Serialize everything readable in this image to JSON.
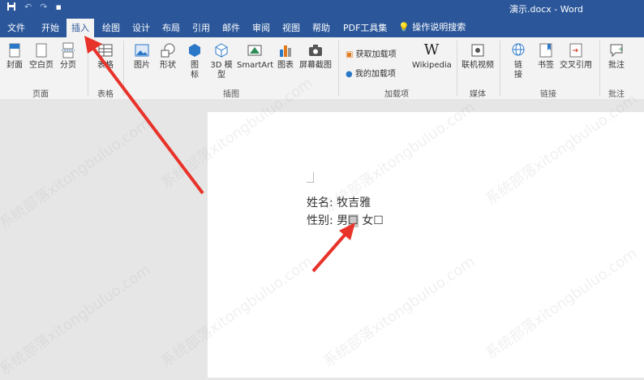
{
  "title": "演示.docx - Word",
  "quick_access": {
    "save_icon": "save-icon",
    "undo_icon": "undo-icon",
    "redo_icon": "redo-icon",
    "more_icon": "more-icon"
  },
  "tabs": [
    "文件",
    "开始",
    "插入",
    "绘图",
    "设计",
    "布局",
    "引用",
    "邮件",
    "审阅",
    "视图",
    "帮助",
    "PDF工具集"
  ],
  "active_tab": "插入",
  "tell_me": "操作说明搜索",
  "ribbon": {
    "pages": {
      "cover": "封面",
      "blank": "空白页",
      "break": "分页",
      "group": "页面"
    },
    "tables": {
      "table": "表格",
      "group": "表格"
    },
    "illustrations": {
      "pictures": "图片",
      "shapes": "形状",
      "icons_a": "图",
      "icons_b": "标",
      "model_a": "3D 模",
      "model_b": "型",
      "smartart": "SmartArt",
      "chart": "图表",
      "screenshot": "屏幕截图",
      "group": "插图"
    },
    "addins": {
      "get": "获取加载项",
      "mine": "我的加载项",
      "wiki_glyph": "W",
      "wikipedia": "Wikipedia",
      "group": "加载项"
    },
    "media": {
      "online_video": "联机视频",
      "group": "媒体"
    },
    "links": {
      "link_a": "链",
      "link_b": "接",
      "bookmark": "书签",
      "cross_ref": "交叉引用",
      "group": "链接"
    },
    "comments": {
      "comment": "批注",
      "group": "批注"
    }
  },
  "document": {
    "line1_label": "姓名:",
    "line1_value": "牧吉雅",
    "line2_label": "性别:",
    "male": "男",
    "checkbox": "☐",
    "female": "女",
    "checkbox2": "☐"
  },
  "watermark": "系统部落xitongbuluo.com",
  "accent": "#2b579a",
  "arrow_color": "#e8332a"
}
